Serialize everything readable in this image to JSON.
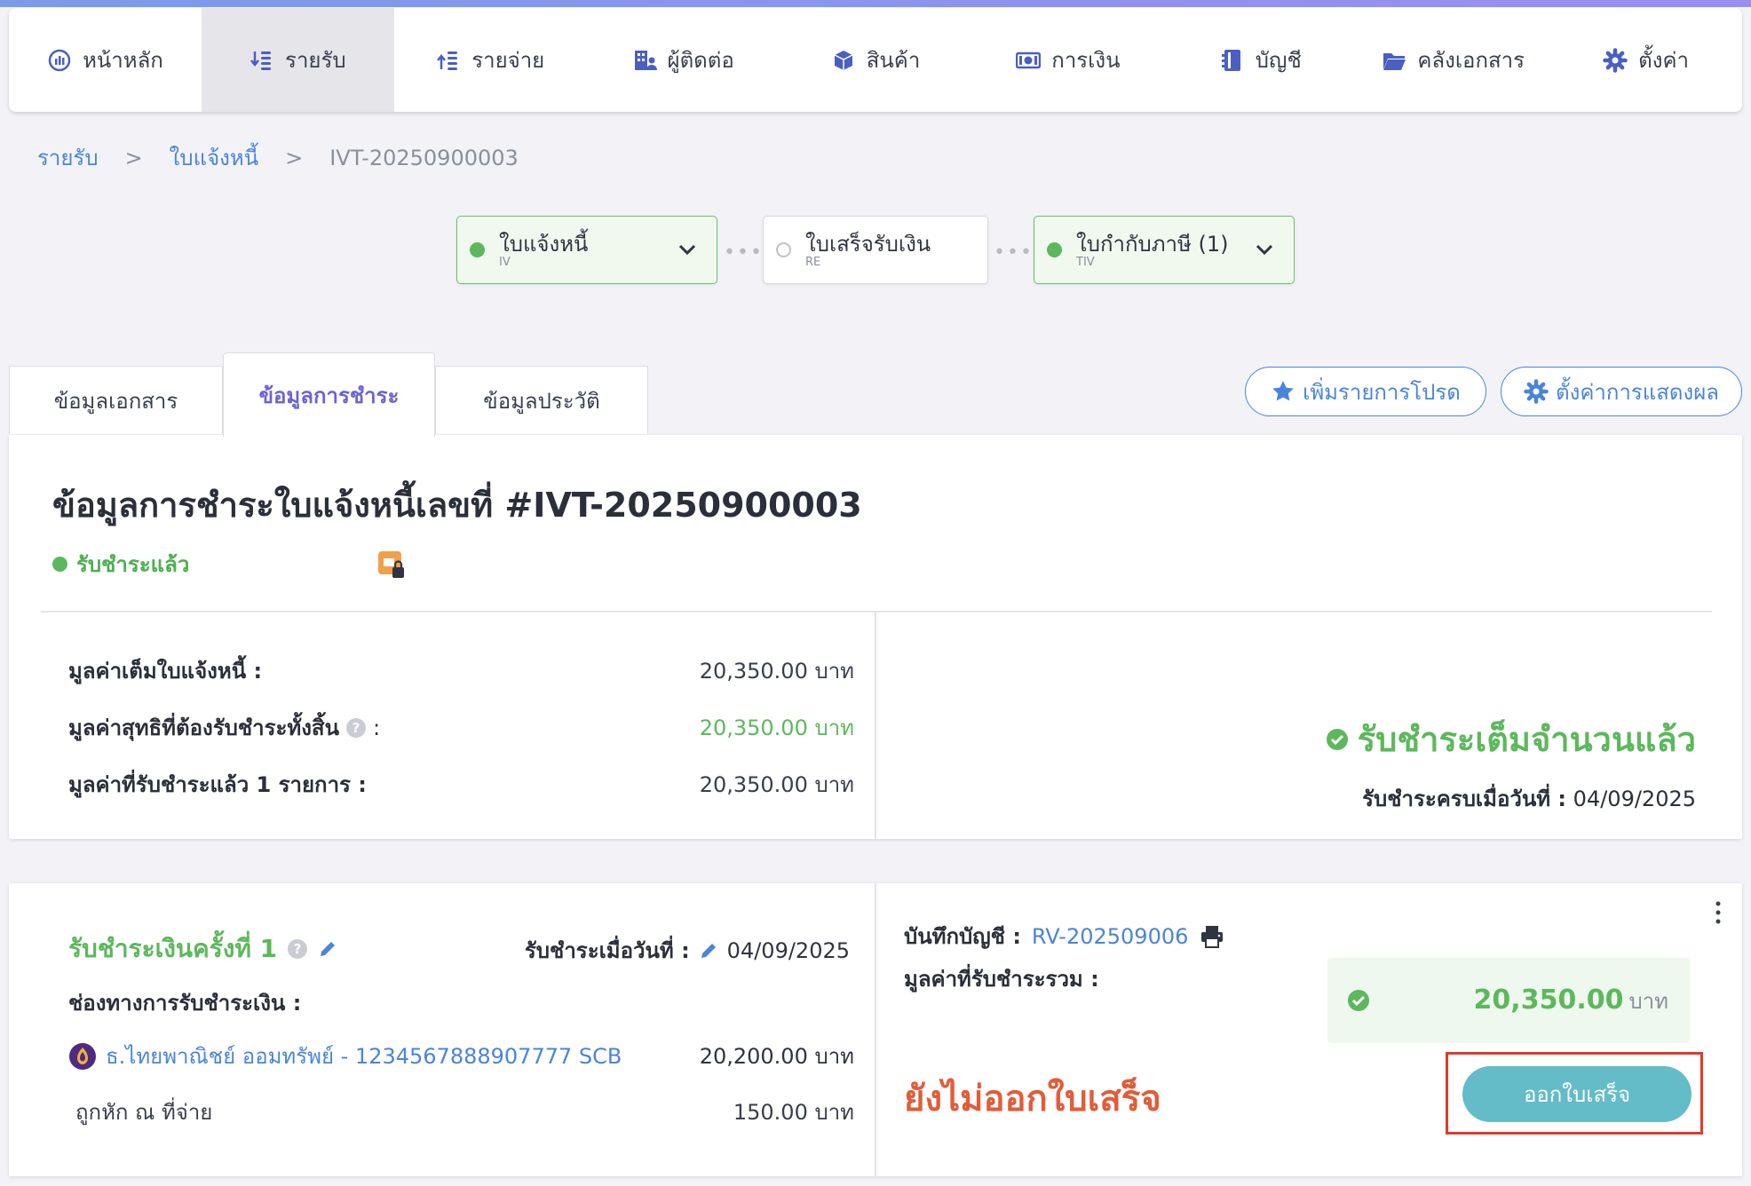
{
  "nav": {
    "items": [
      {
        "label": "หน้าหลัก",
        "icon": "dashboard-icon"
      },
      {
        "label": "รายรับ",
        "icon": "income-icon",
        "active": true
      },
      {
        "label": "รายจ่าย",
        "icon": "expense-icon"
      },
      {
        "label": "ผู้ติดต่อ",
        "icon": "contacts-icon"
      },
      {
        "label": "สินค้า",
        "icon": "box-icon"
      },
      {
        "label": "การเงิน",
        "icon": "money-icon"
      },
      {
        "label": "บัญชี",
        "icon": "ledger-icon"
      },
      {
        "label": "คลังเอกสาร",
        "icon": "folder-icon"
      },
      {
        "label": "ตั้งค่า",
        "icon": "gear-icon"
      }
    ]
  },
  "breadcrumb": {
    "root": "รายรับ",
    "sep": ">",
    "section": "ใบแจ้งหนี้",
    "current": "IVT-20250900003"
  },
  "stepper": {
    "steps": [
      {
        "label": "ใบแจ้งหนี้",
        "code": "IV",
        "done": true
      },
      {
        "label": "ใบเสร็จรับเงิน",
        "code": "RE",
        "done": false
      },
      {
        "label": "ใบกำกับภาษี (1)",
        "code": "TIV",
        "done": true
      }
    ],
    "connector": "•••"
  },
  "tabs": [
    {
      "label": "ข้อมูลเอกสาร"
    },
    {
      "label": "ข้อมูลการชำระ",
      "active": true
    },
    {
      "label": "ข้อมูลประวัติ"
    }
  ],
  "actions": {
    "favorite": "เพิ่มรายการโปรด",
    "display_settings": "ตั้งค่าการแสดงผล"
  },
  "summary": {
    "title": "ข้อมูลการชำระใบแจ้งหนี้เลขที่ #IVT-20250900003",
    "status": "รับชำระแล้ว",
    "rows": [
      {
        "label": "มูลค่าเต็มใบแจ้งหนี้ :",
        "value": "20,350.00 บาท"
      },
      {
        "label": "มูลค่าสุทธิที่ต้องรับชำระทั้งสิ้น",
        "suffix": ":",
        "value": "20,350.00 บาท"
      },
      {
        "label": "มูลค่าที่รับชำระแล้ว 1 รายการ :",
        "value": "20,350.00 บาท"
      }
    ],
    "help_glyph": "?",
    "paid_full": "รับชำระเต็มจำนวนแล้ว",
    "paid_date_label": "รับชำระครบเมื่อวันที่ :",
    "paid_date": "04/09/2025"
  },
  "payment": {
    "title": "รับชำระเงินครั้งที่ 1",
    "date_label": "รับชำระเมื่อวันที่ :",
    "date": "04/09/2025",
    "channel_label": "ช่องทางการรับชำระเงิน :",
    "bank": "ธ.ไทยพาณิชย์ ออมทรัพย์ - 1234567888907777 SCB",
    "bank_amount": "20,200.00 บาท",
    "wht_label": "ถูกหัก ณ ที่จ่าย",
    "wht_amount": "150.00 บาท",
    "account_label": "บันทึกบัญชี :",
    "account_ref": "RV-202509006",
    "total_label": "มูลค่าที่รับชำระรวม :",
    "total_amount": "20,350.00",
    "total_unit": "บาท",
    "not_issued": "ยังไม่ออกใบเสร็จ",
    "issue_button": "ออกใบเสร็จ"
  },
  "colors": {
    "accent_blue": "#4a84dc",
    "success_green": "#5cb85c",
    "warning_orange": "#e25c3a",
    "button_teal": "#63bcc8",
    "tab_active_purple": "#6a63d9"
  }
}
